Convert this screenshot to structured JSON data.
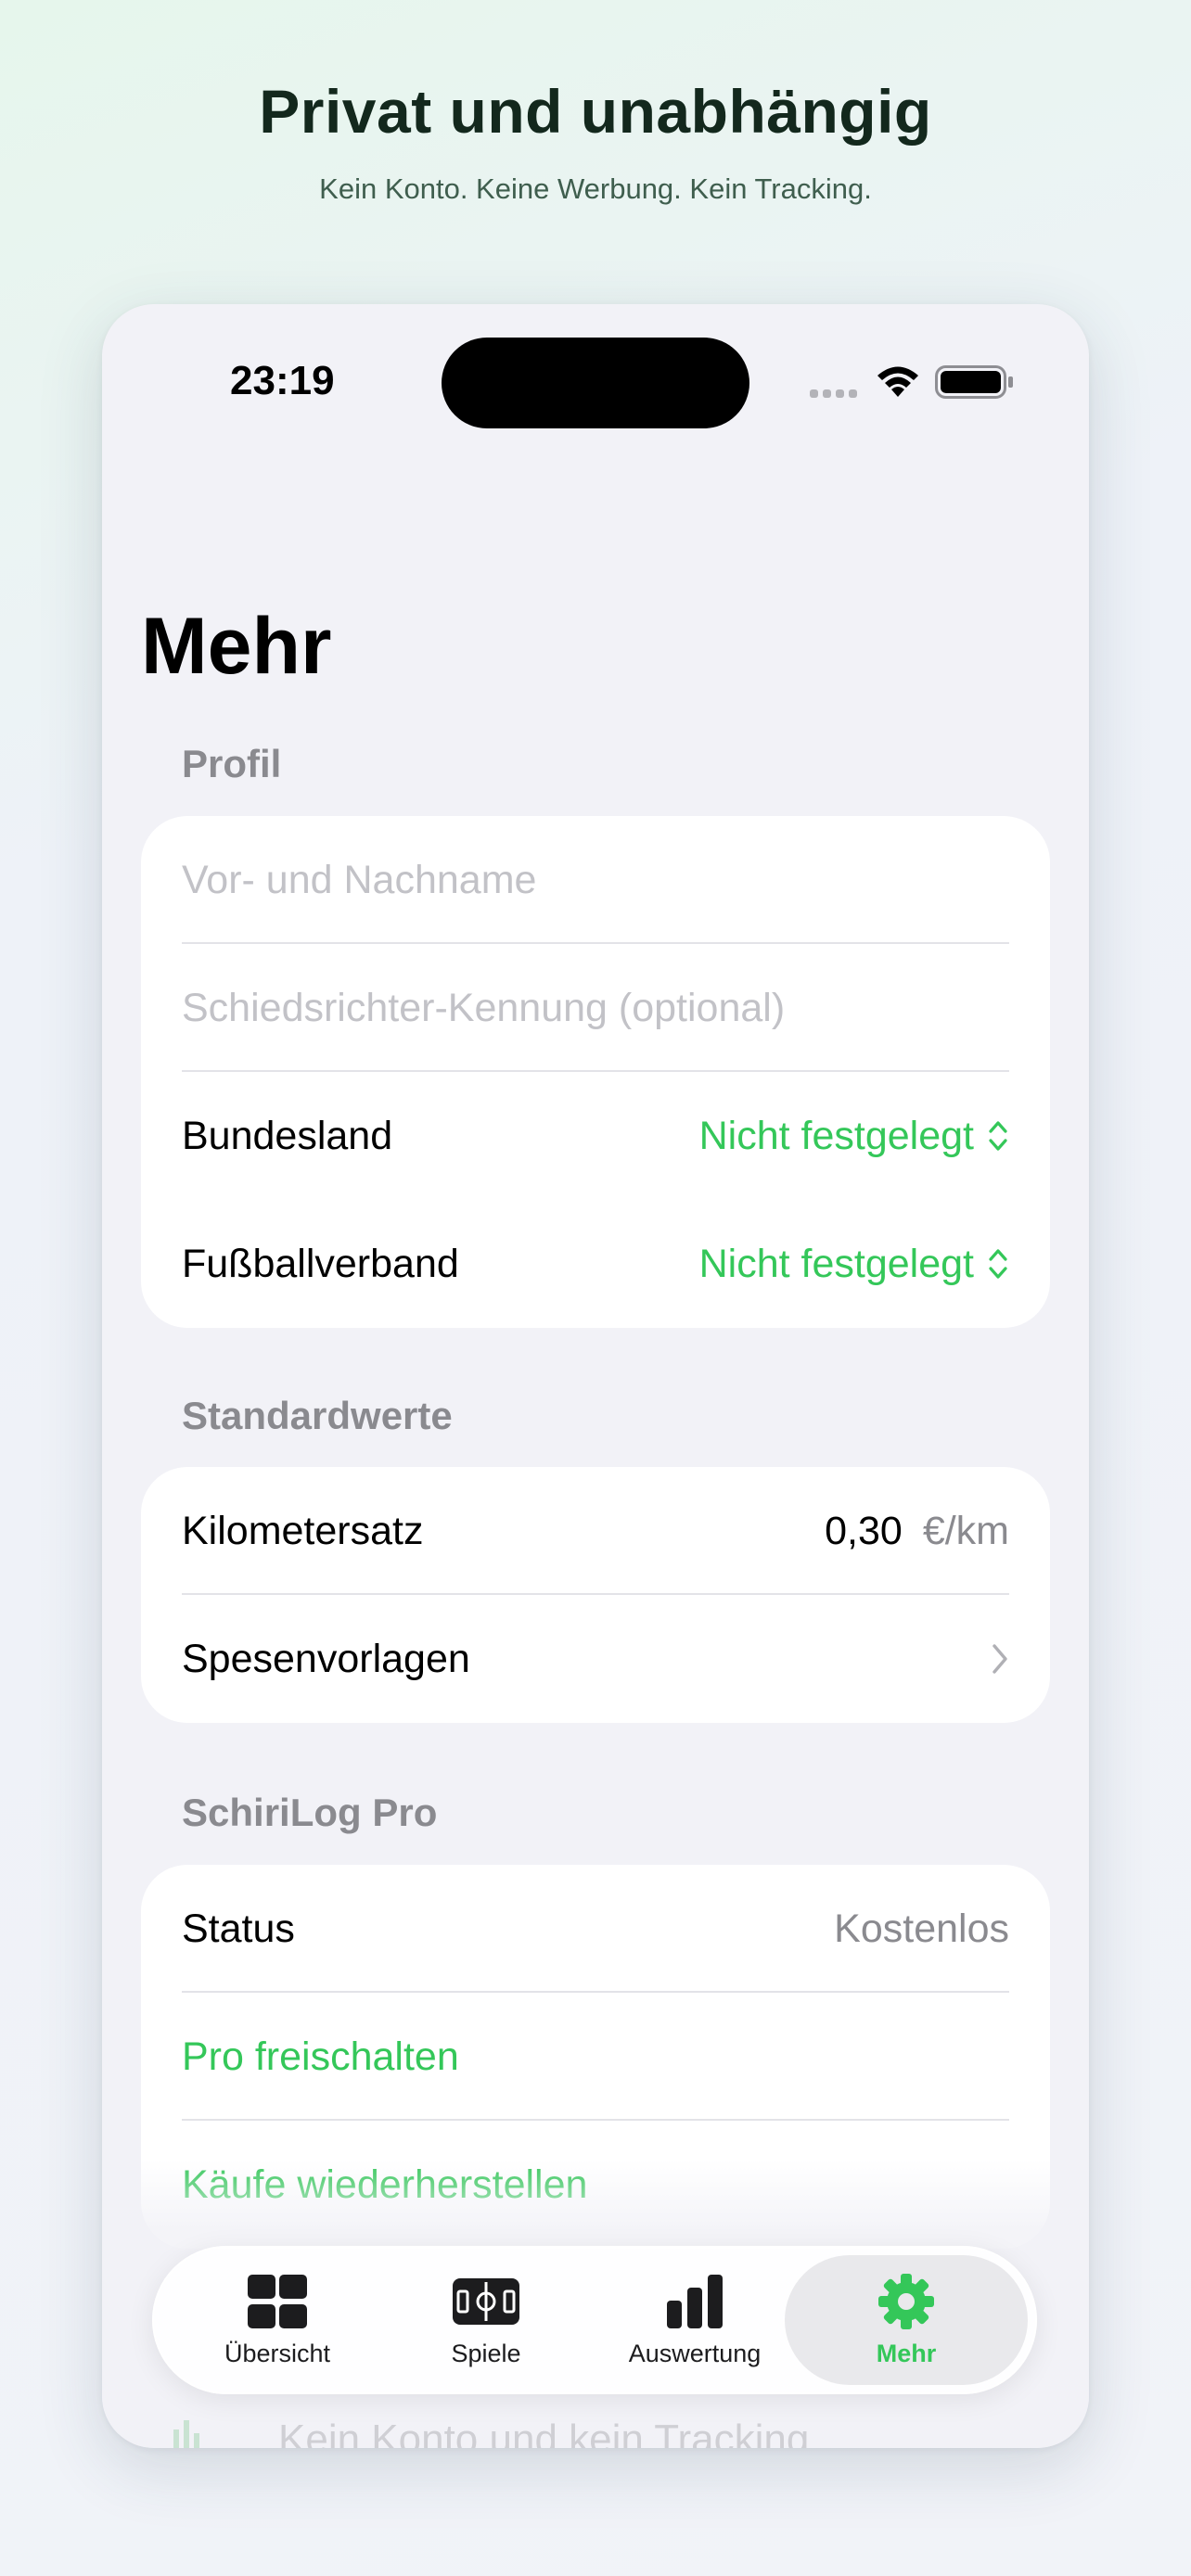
{
  "promo": {
    "title": "Privat und unabhängig",
    "subtitle": "Kein Konto. Keine Werbung. Kein Tracking."
  },
  "status_bar": {
    "time": "23:19"
  },
  "page": {
    "title": "Mehr"
  },
  "profile": {
    "header": "Profil",
    "name_placeholder": "Vor- und Nachname",
    "referee_id_placeholder": "Schiedsrichter-Kennung (optional)",
    "state_label": "Bundesland",
    "state_value": "Nicht festgelegt",
    "association_label": "Fußballverband",
    "association_value": "Nicht festgelegt"
  },
  "defaults": {
    "header": "Standardwerte",
    "mileage_label": "Kilometersatz",
    "mileage_value": "0,30",
    "mileage_unit": "€/km",
    "expense_templates_label": "Spesenvorlagen"
  },
  "pro": {
    "header": "SchiriLog Pro",
    "status_label": "Status",
    "status_value": "Kostenlos",
    "unlock_label": "Pro freischalten",
    "restore_label": "Käufe wiederherstellen"
  },
  "below_fold": {
    "faded_text": "Kein Konto und kein Tracking"
  },
  "tabbar": {
    "tabs": [
      {
        "label": "Übersicht",
        "icon": "grid-icon"
      },
      {
        "label": "Spiele",
        "icon": "pitch-icon"
      },
      {
        "label": "Auswertung",
        "icon": "bar-chart-icon"
      },
      {
        "label": "Mehr",
        "icon": "gear-icon"
      }
    ],
    "active_index": 3
  },
  "colors": {
    "accent": "#34c759",
    "background": "#f2f2f7",
    "secondary_text": "#8a8a8f",
    "placeholder": "#c2c2c7"
  }
}
